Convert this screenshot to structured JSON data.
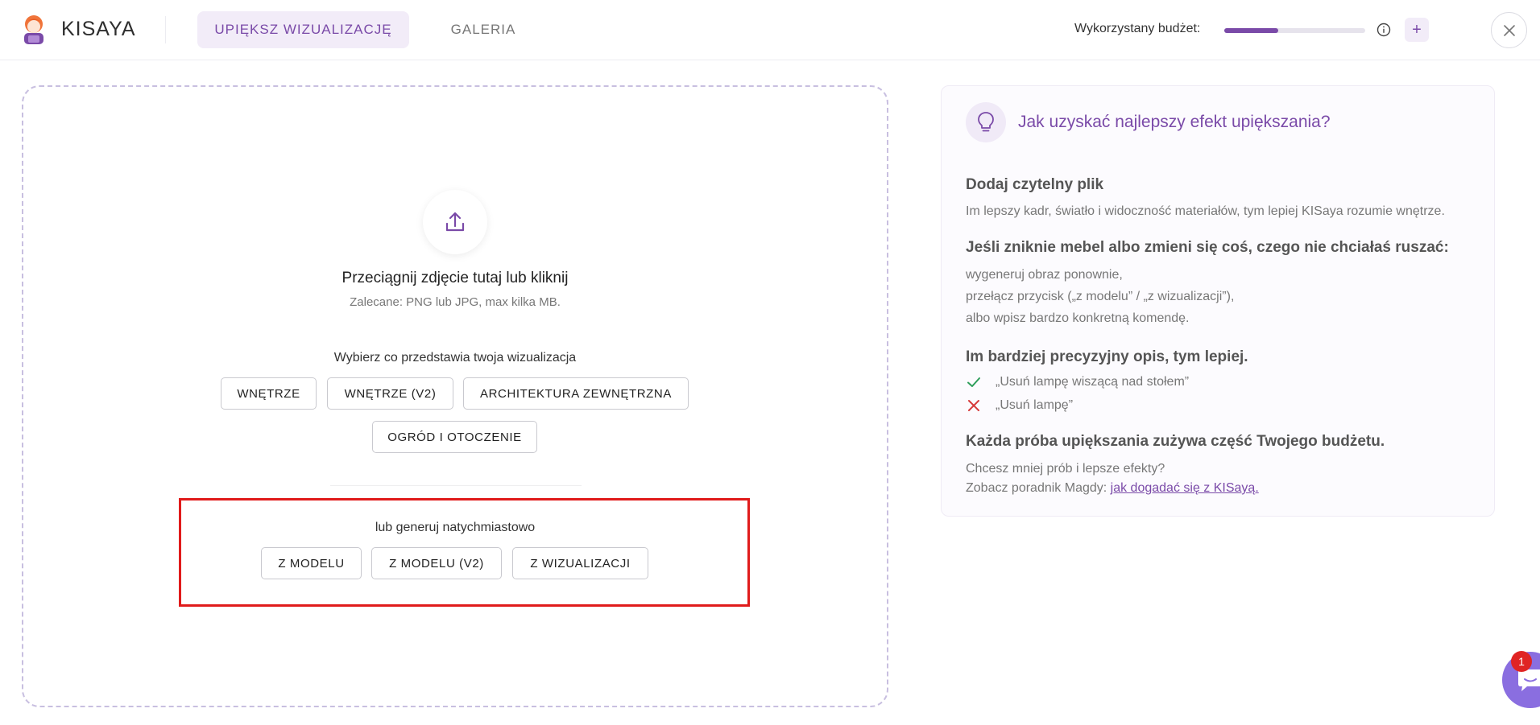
{
  "header": {
    "brand": "KISAYA",
    "tabs": [
      {
        "label": "UPIĘKSZ WIZUALIZACJĘ",
        "active": true
      },
      {
        "label": "GALERIA",
        "active": false
      }
    ],
    "budget_label": "Wykorzystany budżet:",
    "budget_used_fraction": 0.38,
    "plus_label": "+",
    "icons": [
      "kisaya-logo-icon",
      "info-icon",
      "plus-icon",
      "close-icon"
    ]
  },
  "upload": {
    "title": "Przeciągnij zdjęcie tutaj lub kliknij",
    "subtitle": "Zalecane: PNG lub JPG, max kilka MB.",
    "choose_label": "Wybierz co przedstawia twoja wizualizacja",
    "types": [
      "WNĘTRZE",
      "WNĘTRZE (V2)",
      "ARCHITEKTURA ZEWNĘTRZNA",
      "OGRÓD I OTOCZENIE"
    ],
    "instant_label": "lub generuj natychmiastowo",
    "instant": [
      "Z MODELU",
      "Z MODELU (V2)",
      "Z WIZUALIZACJI"
    ]
  },
  "tips": {
    "title": "Jak uzyskać najlepszy efekt upiększania?",
    "s1_title": "Dodaj czytelny plik",
    "s1_text": "Im lepszy kadr, światło i widoczność materiałów, tym lepiej KISaya rozumie wnętrze.",
    "s2_title": "Jeśli zniknie mebel albo zmieni się coś, czego nie chciałaś ruszać:",
    "s2_lines": [
      "wygeneruj obraz ponownie,",
      "przełącz przycisk („z modelu” / „z wizualizacji”),",
      "albo wpisz bardzo konkretną komendę."
    ],
    "s3_title": "Im bardziej precyzyjny opis, tym lepiej.",
    "good_example": "„Usuń lampę wiszącą nad stołem”",
    "bad_example": "„Usuń lampę”",
    "s4_title": "Każda próba upiększania zużywa część Twojego budżetu.",
    "s4_text": "Chcesz mniej prób i lepsze efekty?",
    "s4_link_prefix": "Zobacz poradnik Magdy: ",
    "s4_link": "jak dogadać się z KISayą."
  },
  "chat": {
    "badge": "1"
  },
  "colors": {
    "accent": "#7a4aa8",
    "accent_light": "#f2ecf8",
    "highlight": "#e01b1b",
    "chat": "#8a6ee0"
  }
}
